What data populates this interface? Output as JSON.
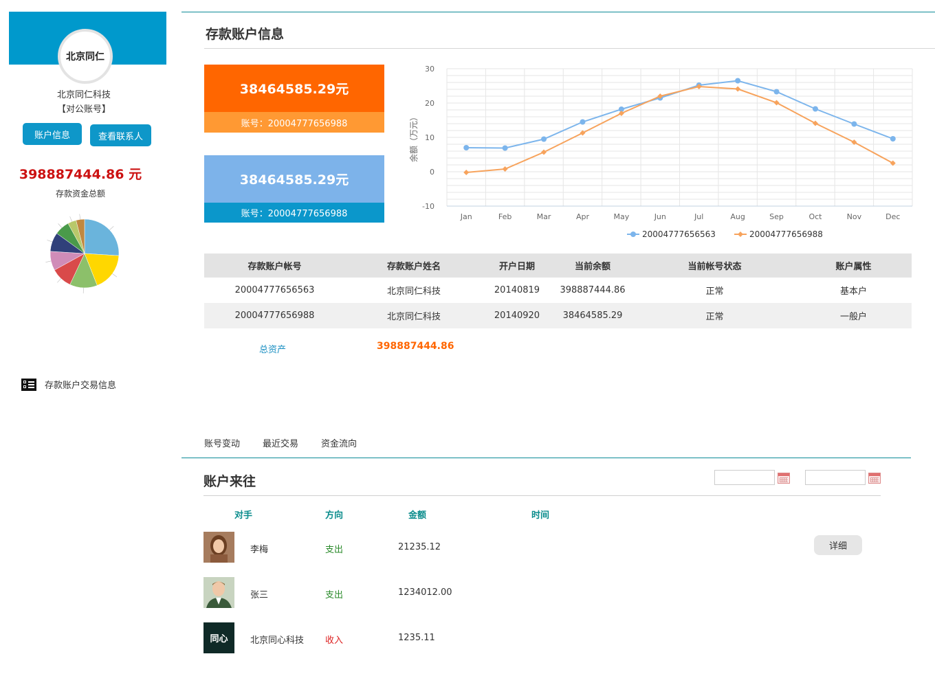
{
  "sidebar": {
    "avatar_text": "北京同仁",
    "company_name": "北京同仁科技",
    "account_kind": "【对公账号】",
    "btn_info": "账户信息",
    "btn_contacts": "查看联系人",
    "total_amount": "398887444.86 元",
    "total_label": "存款资金总额",
    "menu_label": "存款账户交易信息"
  },
  "pie_chart": {
    "type": "pie",
    "values": [
      26,
      18,
      13,
      10,
      9,
      9,
      7,
      4,
      4
    ],
    "colors": [
      "#6ab4dc",
      "#ffd700",
      "#8cc06a",
      "#d94a4a",
      "#d08cb8",
      "#30407a",
      "#4a9a4a",
      "#b8c86a",
      "#c08840"
    ]
  },
  "header": {
    "title": "存款账户信息"
  },
  "cards": [
    {
      "amount": "38464585.29元",
      "account": "账号：20004777656988"
    },
    {
      "amount": "38464585.29元",
      "account": "账号：20004777656988"
    }
  ],
  "colors": {
    "orange": "#ff6600",
    "light_orange": "#ff9933",
    "blue": "#0b97cb",
    "light_blue": "#7db3ea",
    "teal": "#0a8c8c",
    "red": "#cc1111"
  },
  "chart_data": {
    "type": "line",
    "categories": [
      "Jan",
      "Feb",
      "Mar",
      "Apr",
      "May",
      "Jun",
      "Jul",
      "Aug",
      "Sep",
      "Oct",
      "Nov",
      "Dec"
    ],
    "ylabel": "余额（万元）",
    "ylim": [
      -10,
      30
    ],
    "yticks": [
      30,
      20,
      10,
      0,
      -10
    ],
    "grid": true,
    "legend_position": "bottom",
    "series": [
      {
        "name": "20004777656563",
        "color": "#7cb5ec",
        "values": [
          7.0,
          6.9,
          9.5,
          14.5,
          18.2,
          21.5,
          25.2,
          26.5,
          23.3,
          18.3,
          13.9,
          9.6
        ]
      },
      {
        "name": "20004777656988",
        "color": "#f7a35c",
        "values": [
          -0.2,
          0.8,
          5.7,
          11.3,
          17.0,
          22.0,
          24.8,
          24.1,
          20.1,
          14.1,
          8.6,
          2.5
        ]
      }
    ]
  },
  "table": {
    "headers": [
      "存款账户帐号",
      "存款账户姓名",
      "开户日期",
      "当前余额",
      "当前帐号状态",
      "账户属性"
    ],
    "rows": [
      [
        "20004777656563",
        "北京同仁科技",
        "20140819",
        "398887444.86",
        "正常",
        "基本户"
      ],
      [
        "20004777656988",
        "北京同仁科技",
        "20140920",
        "38464585.29",
        "正常",
        "一般户"
      ]
    ],
    "assets_label": "总资产",
    "assets_value": "398887444.86"
  },
  "tabs": [
    "账号变动",
    "最近交易",
    "资金流向"
  ],
  "section": {
    "title": "账户来往",
    "col_counterparty": "对手",
    "col_direction": "方向",
    "col_amount": "金额",
    "col_time": "时间",
    "detail_label": "详细"
  },
  "transactions": [
    {
      "name": "李梅",
      "direction": "支出",
      "amount": "21235.12",
      "direction_color": "#2a8a2a"
    },
    {
      "name": "张三",
      "direction": "支出",
      "amount": "1234012.00",
      "direction_color": "#2a8a2a"
    },
    {
      "name": "北京同心科技",
      "direction": "收入",
      "amount": "1235.11",
      "direction_color": "#dd2222",
      "logo_text": "同心"
    }
  ]
}
